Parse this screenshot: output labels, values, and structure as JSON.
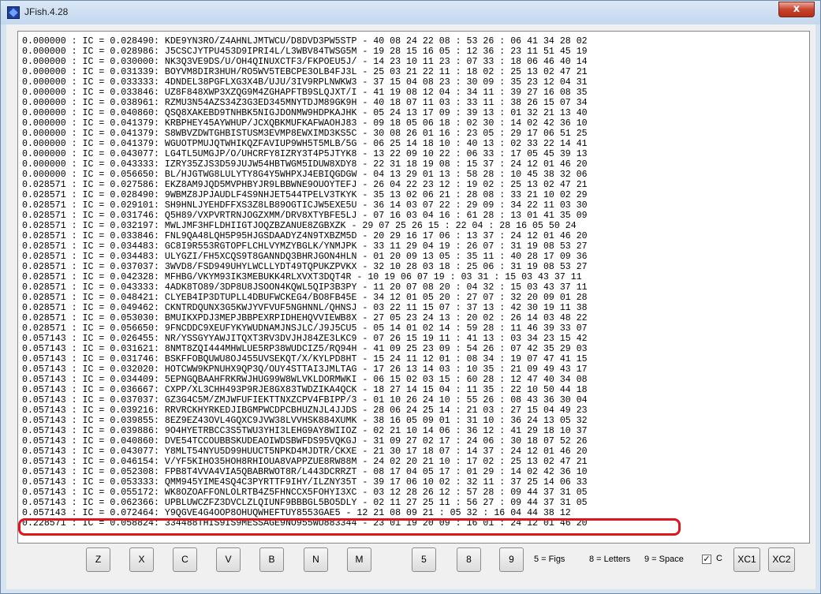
{
  "window": {
    "title": "JFish.4.28",
    "close_glyph": "x"
  },
  "output_lines": [
    "0.000000 : IC = 0.028490: KDE9YN3RO/Z4AHNLJMTWCU/D8DVD3PW5STP - 40 08 24 22 08 : 53 26 : 06 41 34 28 02",
    "0.000000 : IC = 0.028986: J5CSCJYTPU453D9IPRI4L/L3WBV84TWSG5M - 19 28 15 16 05 : 12 36 : 23 11 51 45 19",
    "0.000000 : IC = 0.030000: NK3Q3VE9DS/U/OH4QINUXCTF3/FKPOEU5J/ - 14 23 10 11 23 : 07 33 : 18 06 46 40 14",
    "0.000000 : IC = 0.031339: BOYVM8DIR3HUH/RO5WV5TEBCPE3OLB4FJ3L - 25 03 21 22 11 : 18 02 : 25 13 02 47 21",
    "0.000000 : IC = 0.033333: 4DNDEL38PGFLXG3X4B/UJU/3IV9RPLNWKW3 - 37 15 04 08 23 : 30 09 : 35 23 12 04 31",
    "0.000000 : IC = 0.033846: UZ8F848XWP3XZQG9M4ZGHAPFTB9SLQJXT/I - 41 19 08 12 04 : 34 11 : 39 27 16 08 35",
    "0.000000 : IC = 0.038961: RZMU3N54AZS34Z3G3ED345MNYTDJM89GK9H - 40 18 07 11 03 : 33 11 : 38 26 15 07 34",
    "0.000000 : IC = 0.040860: QSQ8XAKEBD9TNHBK5NIGJDONMW9HDPKAJHK - 05 24 13 17 09 : 39 13 : 01 32 21 13 40",
    "0.000000 : IC = 0.041379: KRBPHEY45AYWHUP/JCXQBKMUFKAFWAOHJ83 - 09 18 05 06 18 : 02 30 : 14 02 42 36 10",
    "0.000000 : IC = 0.041379: S8WBVZDWTGHBISTUSM3EVMP8EWXIMD3KS5C - 30 08 26 01 16 : 23 05 : 29 17 06 51 25",
    "0.000000 : IC = 0.041379: WGUOTPMUJQTWHIKQZFAVIUP9WH5T5MLB/5G - 06 25 14 18 10 : 40 13 : 02 33 22 14 41",
    "0.000000 : IC = 0.043077: LG4TL5UMGJP/O/UHCRFY8IZRY3T4P5JTYK8 - 13 22 09 10 22 : 06 33 : 17 05 45 39 13",
    "0.000000 : IC = 0.043333: IZRY35ZJS3D59JUJW54HBTWGM5IDUW8XDY8 - 22 31 18 19 08 : 15 37 : 24 12 01 46 20",
    "0.000000 : IC = 0.056650: BL/HJGTWG8LULYTY8G4Y5WHPXJ4EBIQGDGW - 04 13 29 01 13 : 58 28 : 10 45 38 32 06",
    "0.028571 : IC = 0.027586: EKZ8AM9JQD5MVPHBYJR9LBBWNE9OUOYTEFJ - 26 04 22 23 12 : 19 02 : 25 13 02 47 21",
    "0.028571 : IC = 0.028490: 9WBMZ8JPJAUDLF4S9NHJET544TPELV3TKYK - 35 13 02 06 21 : 28 08 : 33 21 10 02 29",
    "0.028571 : IC = 0.029101: SH9HNLJYEHDFFXS3Z8LB89OGTICJW5EXE5U - 36 14 03 07 22 : 29 09 : 34 22 11 03 30",
    "0.028571 : IC = 0.031746: Q5H89/VXPVRTRNJOGZXMM/DRV8XTYBFE5LJ - 07 16 03 04 16 : 61 28 : 13 01 41 35 09",
    "0.028571 : IC = 0.032197: MWLJMF3HFLDHIIGTJOQZBZANUE8ZGBXZK - 29 07 25 26 15 : 22 04 : 28 16 05 50 24",
    "0.028571 : IC = 0.033846: FNL9QA48LQH5P95HJGSDAADYZ4N9TXBZM5D - 20 29 16 17 06 : 13 37 : 24 12 01 46 20",
    "0.028571 : IC = 0.034483: GC8I9R553RGTOPFLCHLVYMZYBGLK/YNMJPK - 33 11 29 04 19 : 26 07 : 31 19 08 53 27",
    "0.028571 : IC = 0.034483: ULYGZI/FH5XCQS9T8GANNDQ3BHRJGON4HLN - 01 20 09 13 05 : 35 11 : 40 28 17 09 36",
    "0.028571 : IC = 0.037037: 3WVD8/FSD949UHYLWCLLYDT49TQPUKZPVKX - 32 10 28 03 18 : 25 06 : 31 19 08 53 27",
    "0.028571 : IC = 0.042328: MFHBG/VKYM93IK3MEBUKK4RLXVXT3DQT4R - 10 19 06 07 19 : 03 31 : 15 03 43 37 11",
    "0.028571 : IC = 0.043333: 4ADK8TO89/3DP8U8JSOON4KQWL5QIP3B3PY - 11 20 07 08 20 : 04 32 : 15 03 43 37 11",
    "0.028571 : IC = 0.048421: CLYEB4IP3DTUPLL4DBUFWCKEG4/BO8FB45E - 34 12 01 05 20 : 27 07 : 32 20 09 01 28",
    "0.028571 : IC = 0.049462: CKNTRDQUNX3G5KWJYVFVUF5NGHNNL/QHNSJ - 03 22 11 15 07 : 37 13 : 42 30 19 11 38",
    "0.028571 : IC = 0.053030: BMUIKXPDJ3MEPJBBPEXRPIDHEHQVVIEWB8X - 27 05 23 24 13 : 20 02 : 26 14 03 48 22",
    "0.028571 : IC = 0.056650: 9FNCDDC9XEUFYKYWUDNAMJNSJLC/J9J5CU5 - 05 14 01 02 14 : 59 28 : 11 46 39 33 07",
    "0.057143 : IC = 0.026455: NR/YSSGYYAWJITQXT3RV3DVJHJ84ZE3LKC9 - 07 26 15 19 11 : 41 13 : 03 34 23 15 42",
    "0.057143 : IC = 0.031621: 8NMT8ZQI444MHWLUE5RP38WUDCIZ5/RQ94H - 41 09 25 23 09 : 54 26 : 07 42 35 29 03",
    "0.057143 : IC = 0.031746: BSKFFOBQUWU8OJ455UVSEKQT/X/KYLPD8HT - 15 24 11 12 01 : 08 34 : 19 07 47 41 15",
    "0.057143 : IC = 0.032020: HOTCWW9KPNUHX9QP3Q/OUY4STTAI3JMLTAG - 17 26 13 14 03 : 10 35 : 21 09 49 43 17",
    "0.057143 : IC = 0.034409: 5EPNGQBAAHFRKRWJHUG99W8WLVKLDORMWKI - 06 15 02 03 15 : 60 28 : 12 47 40 34 08",
    "0.057143 : IC = 0.036667: CXPP/XL3CHH493P9RJE8GX83TWDZIKA4QCK - 18 27 14 15 04 : 11 35 : 22 10 50 44 18",
    "0.057143 : IC = 0.037037: GZ3G4C5M/ZMJWFUFIEKTTNXZCPV4FBIPP/3 - 01 10 26 24 10 : 55 26 : 08 43 36 30 04",
    "0.057143 : IC = 0.039216: RRVRCKHYRKEDJIBGMPWCDPCBHUZNJL4JJDS - 28 06 24 25 14 : 21 03 : 27 15 04 49 23",
    "0.057143 : IC = 0.039855: 8EZ9EZ43OVL4GQXC9JVW38LVVHSK884XUMK - 38 16 05 09 01 : 31 10 : 36 24 13 05 32",
    "0.057143 : IC = 0.039886: 9O4HYETRBCC3S5TWU3YHI3LEHG9AY8WIIOZ - 02 21 10 14 06 : 36 12 : 41 29 18 10 37",
    "0.057143 : IC = 0.040860: DVE54TCCOUBBSKUDEAOIWDSBWFDS95VQKGJ - 31 09 27 02 17 : 24 06 : 30 18 07 52 26",
    "0.057143 : IC = 0.043077: Y8MLT54NYU5D99HUUCT5NPKD4MJDTR/CKXE - 21 30 17 18 07 : 14 37 : 24 12 01 46 20",
    "0.057143 : IC = 0.046154: V/YF5KIHO35HOH8RHIOUA8VAPPZUE8RW88M - 24 02 20 21 10 : 17 02 : 25 13 02 47 21",
    "0.057143 : IC = 0.052308: FPB8T4VVA4VIA5QBABRWOT8R/L443DCRRZT - 08 17 04 05 17 : 01 29 : 14 02 42 36 10",
    "0.057143 : IC = 0.053333: QMM945YIME4SQ4C3PYRTTF9IHY/ILZNY35T - 39 17 06 10 02 : 32 11 : 37 25 14 06 33",
    "0.057143 : IC = 0.055172: WK8OZOAFFONLOLRTB4Z5FHNCCX5FOHYI3XC - 03 12 28 26 12 : 57 28 : 09 44 37 31 05",
    "0.057143 : IC = 0.062366: UPBLUWCZFZ3DVCLZLQIUNF9BBBGL5BO5DLY - 02 11 27 25 11 : 56 27 : 09 44 37 31 05",
    "0.057143 : IC = 0.072464: Y9QGVE4G4OOP8OHUQWHEFTUY8553GAE5 - 12 21 08 09 21 : 05 32 : 16 04 44 38 12",
    "0.228571 : IC = 0.058824: 334488THIS9IS9MESSAGE9NO955WU883344 - 23 01 19 20 09 : 16 01 : 24 12 01 46 20"
  ],
  "buttons": {
    "z": "Z",
    "x": "X",
    "c": "C",
    "v": "V",
    "b": "B",
    "n": "N",
    "m": "M",
    "five": "5",
    "eight": "8",
    "nine": "9",
    "xc1": "XC1",
    "xc2": "XC2"
  },
  "legend": {
    "figs": "5 = Figs",
    "letters": "8 = Letters",
    "space": "9 = Space"
  },
  "checkbox": {
    "label": "C",
    "checked": true,
    "check_glyph": "✓"
  }
}
